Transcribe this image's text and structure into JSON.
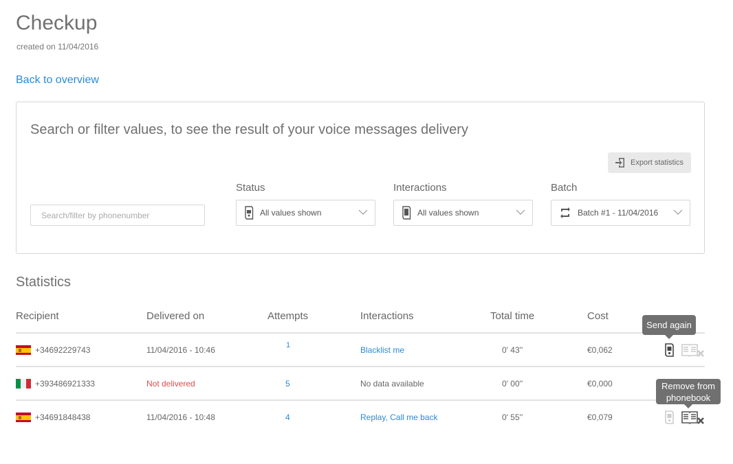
{
  "page": {
    "title": "Checkup",
    "subtitle": "created on 11/04/2016",
    "back_link": "Back to overview"
  },
  "filter": {
    "heading": "Search or filter values, to see the result of your voice messages delivery",
    "export_label": "Export statistics",
    "search_placeholder": "Search/filter by phonenumber",
    "status": {
      "label": "Status",
      "value": "All values shown",
      "icon": "phone-status-icon"
    },
    "interactions": {
      "label": "Interactions",
      "value": "All values shown",
      "icon": "phone-interaction-icon"
    },
    "batch": {
      "label": "Batch",
      "value": "Batch #1 - 11/04/2016",
      "icon": "repeat-icon"
    }
  },
  "statistics": {
    "title": "Statistics",
    "columns": [
      "Recipient",
      "Delivered on",
      "Attempts",
      "Interactions",
      "Total time",
      "Cost"
    ],
    "rows": [
      {
        "flag": "es",
        "phone": "+34692229743",
        "delivered": "11/04/2016 - 10:46",
        "delivered_ok": true,
        "attempts": "1",
        "interactions": "Blacklist me",
        "interactions_link": true,
        "total_time": "0' 43''",
        "cost": "€0,062"
      },
      {
        "flag": "it",
        "phone": "+393486921333",
        "delivered": "Not delivered",
        "delivered_ok": false,
        "attempts": "5",
        "interactions": "No data available",
        "interactions_link": false,
        "total_time": "0' 00''",
        "cost": "€0,000"
      },
      {
        "flag": "es",
        "phone": "+34691848438",
        "delivered": "11/04/2016 - 10:48",
        "delivered_ok": true,
        "attempts": "4",
        "interactions": "Replay, Call me back",
        "interactions_link": true,
        "total_time": "0' 55''",
        "cost": "€0,079"
      }
    ]
  },
  "tooltips": {
    "send_again": "Send again",
    "remove_line1": "Remove from",
    "remove_line2": "phonebook"
  }
}
